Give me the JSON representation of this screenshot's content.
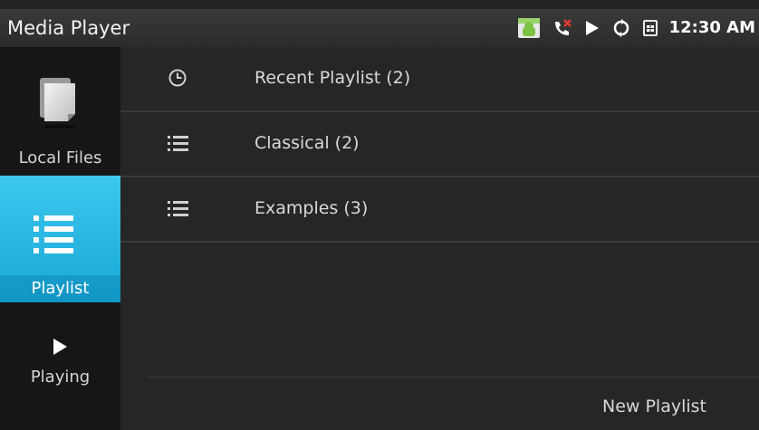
{
  "statusbar": {
    "title": "Media Player",
    "time": "12:30 AM",
    "icons": [
      "android-notification-icon",
      "missed-call-icon",
      "play-status-icon",
      "sync-icon",
      "sim-card-icon"
    ]
  },
  "sidebar": {
    "items": [
      {
        "label": "Local Files",
        "icon": "files-icon",
        "selected": false
      },
      {
        "label": "Playlist",
        "icon": "playlist-icon",
        "selected": true
      },
      {
        "label": "Playing",
        "icon": "play-icon",
        "selected": false
      }
    ]
  },
  "playlists": [
    {
      "label": "Recent Playlist  (2)",
      "icon": "clock-icon"
    },
    {
      "label": "Classical  (2)",
      "icon": "list-icon"
    },
    {
      "label": "Examples  (3)",
      "icon": "list-icon"
    }
  ],
  "actions": {
    "new_playlist": "New Playlist"
  },
  "colors": {
    "accent": "#29b6e6",
    "background": "#262626",
    "sidebar": "#161616"
  }
}
